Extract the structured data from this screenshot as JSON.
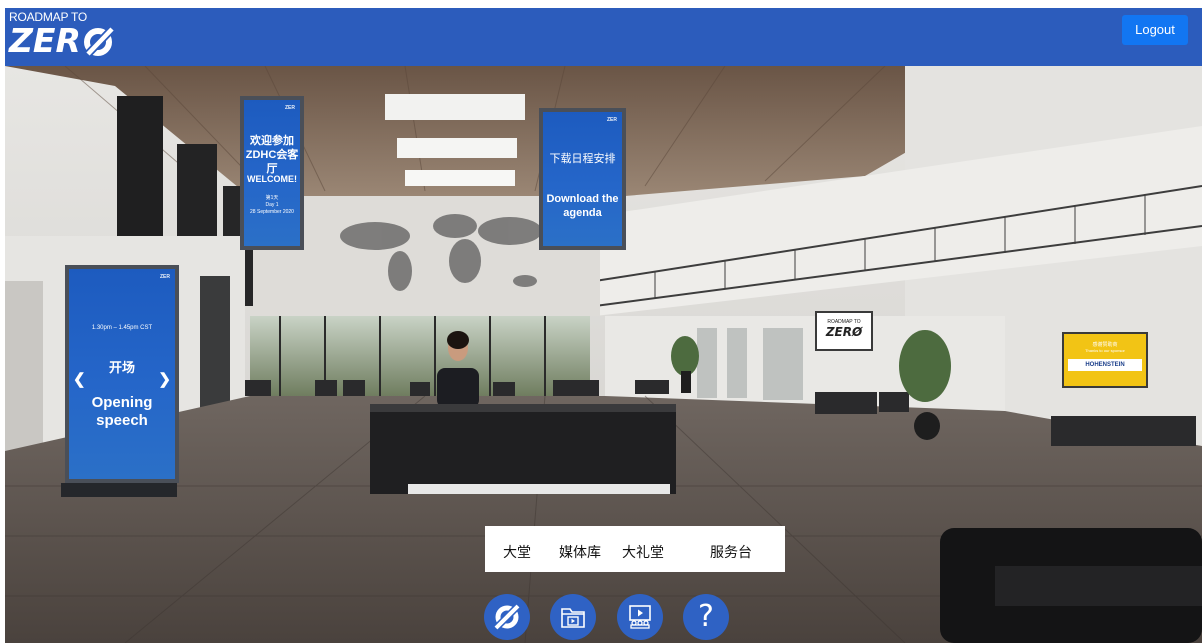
{
  "header": {
    "logo_top": "ROADMAP TO",
    "logo_word": "ZER",
    "logout_label": "Logout",
    "bg_color": "#2c5cbc",
    "logout_color": "#1276f2"
  },
  "scene": {
    "welcome_banner": {
      "corner": "ZER",
      "zh": "欢迎参加 ZDHC会客厅",
      "en": "WELCOME!",
      "small1": "第1天",
      "small2": "Day 1",
      "small3": "28 September 2020"
    },
    "agenda_banner": {
      "corner": "ZER",
      "zh": "下载日程安排",
      "en": "Download the agenda"
    },
    "stand_banner": {
      "corner": "ZER",
      "time": "1.30pm – 1.45pm CST",
      "zh": "开场",
      "en": "Opening speech",
      "prev_icon": "chevron-left-icon",
      "next_icon": "chevron-right-icon"
    },
    "wall_logo": {
      "top": "ROADMAP TO",
      "word": "ZERØ"
    },
    "sponsor_frame": {
      "zh": "感谢赞助商",
      "en": "Thanks to our sponsor",
      "brand": "HOHENSTEIN"
    }
  },
  "nav": {
    "labels": [
      "大堂",
      "媒体库",
      "大礼堂",
      "服务台"
    ],
    "buttons": [
      {
        "icon": "zero-logo-icon"
      },
      {
        "icon": "media-folder-icon"
      },
      {
        "icon": "auditorium-icon"
      },
      {
        "icon": "help-icon",
        "glyph": "?"
      }
    ],
    "button_color": "#2f62c4"
  }
}
